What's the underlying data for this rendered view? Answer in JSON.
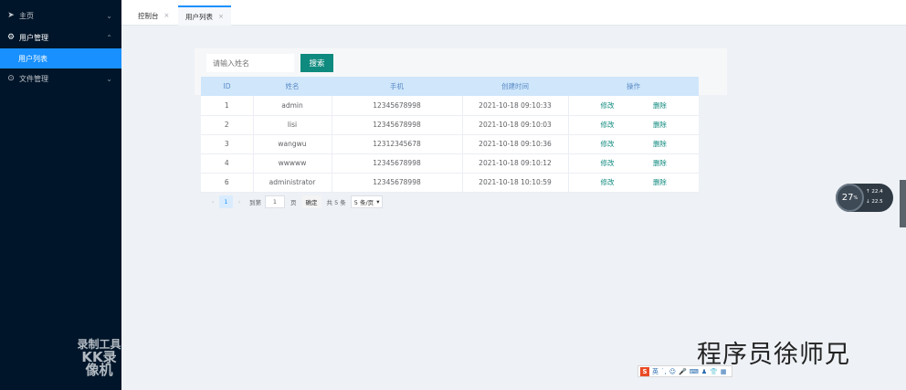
{
  "sidebar": {
    "items": [
      {
        "label": "主页",
        "icon": "send-icon"
      },
      {
        "label": "用户管理",
        "icon": "user-group-icon"
      },
      {
        "label": "用户列表"
      },
      {
        "label": "文件管理",
        "icon": "folder-icon"
      }
    ]
  },
  "watermark": {
    "line1": "录制工具",
    "line2": "KK录像机"
  },
  "tabs": [
    {
      "label": "控制台"
    },
    {
      "label": "用户列表"
    }
  ],
  "search": {
    "placeholder": "请输入姓名",
    "button": "搜索"
  },
  "table": {
    "headers": [
      "ID",
      "姓名",
      "手机",
      "创建时间",
      "操作"
    ],
    "rows": [
      {
        "id": "1",
        "name": "admin",
        "phone": "12345678998",
        "created": "2021-10-18 09:10:33"
      },
      {
        "id": "2",
        "name": "lisi",
        "phone": "12345678998",
        "created": "2021-10-18 09:10:03"
      },
      {
        "id": "3",
        "name": "wangwu",
        "phone": "12312345678",
        "created": "2021-10-18 09:10:36"
      },
      {
        "id": "4",
        "name": "wwwww",
        "phone": "12345678998",
        "created": "2021-10-18 09:10:12"
      },
      {
        "id": "6",
        "name": "administrator",
        "phone": "12345678998",
        "created": "2021-10-18 10:10:59"
      }
    ],
    "edit_label": "修改",
    "delete_label": "删除"
  },
  "pagination": {
    "current": "1",
    "goto_label": "到第",
    "goto_value": "1",
    "page_unit": "页",
    "confirm": "确定",
    "total": "共 5 条",
    "page_size": "5 条/页"
  },
  "speed_widget": {
    "percent": "27",
    "percent_unit": "%",
    "upload": "22.4",
    "download": "22.5"
  },
  "brand": "程序员徐师兄",
  "ime": {
    "logo": "S",
    "mode": "英"
  },
  "colors": {
    "sidebar": "#001529",
    "accent": "#1890ff",
    "button": "#0f8a7e",
    "header_row": "#cfe6fb"
  }
}
